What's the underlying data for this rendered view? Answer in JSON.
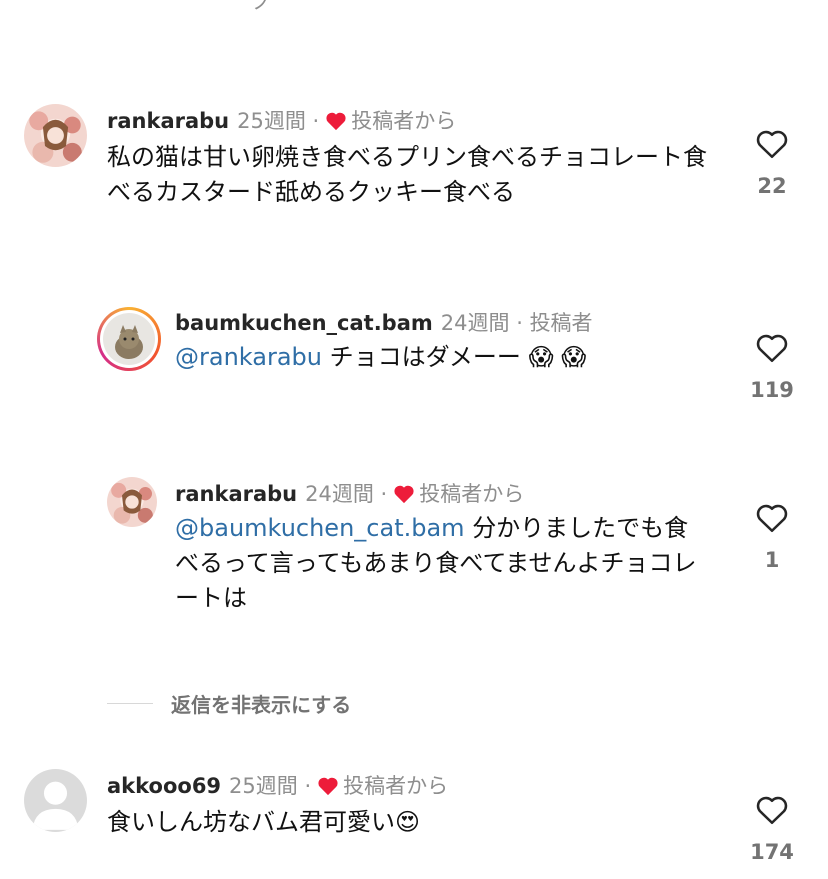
{
  "comments": [
    {
      "username": "rankarabu",
      "time": "25週間",
      "sep": "·",
      "badge": "投稿者から",
      "text": "私の猫は甘い卵焼き食べるプリン食べるチョコレート食べるカスタード舐めるクッキー食べる",
      "likes": "22"
    },
    {
      "username": "baumkuchen_cat.bam",
      "time": "24週間",
      "sep": "·",
      "badge": "投稿者",
      "mention": "@rankarabu",
      "text": "チョコはダメーー",
      "emoji": "😱 😱",
      "likes": "119"
    },
    {
      "username": "rankarabu",
      "time": "24週間",
      "sep": "·",
      "badge": "投稿者から",
      "mention": "@baumkuchen_cat.bam",
      "text": "分かりましたでも食べるって言ってもあまり食べてませんよチョコレートは",
      "likes": "1"
    },
    {
      "username": "akkooo69",
      "time": "25週間",
      "sep": "·",
      "badge": "投稿者から",
      "text": "食いしん坊なバム君可愛い",
      "emoji": "😍",
      "likes": "174"
    }
  ],
  "hide_replies_label": "返信を非表示にする",
  "colors": {
    "mention": "#2f6ea6",
    "heart_badge": "#ed1c3a",
    "meta": "#8e8e8e"
  }
}
